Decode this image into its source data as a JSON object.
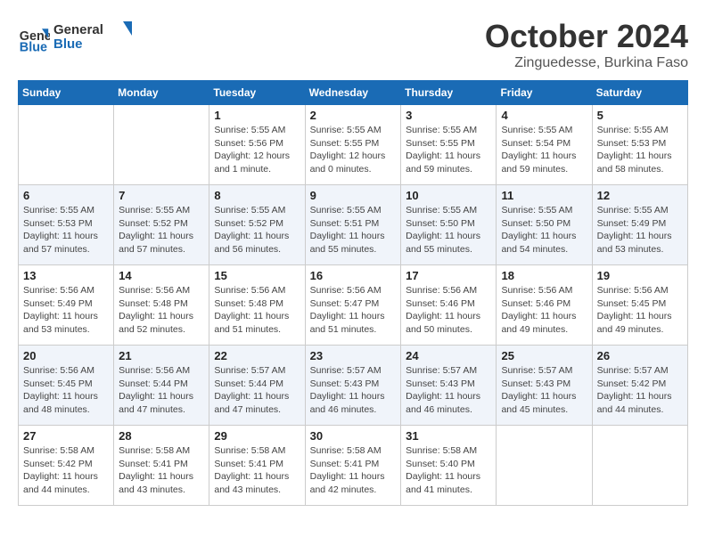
{
  "header": {
    "logo_line1": "General",
    "logo_line2": "Blue",
    "month": "October 2024",
    "location": "Zinguedesse, Burkina Faso"
  },
  "days_of_week": [
    "Sunday",
    "Monday",
    "Tuesday",
    "Wednesday",
    "Thursday",
    "Friday",
    "Saturday"
  ],
  "weeks": [
    [
      {
        "day": "",
        "info": ""
      },
      {
        "day": "",
        "info": ""
      },
      {
        "day": "1",
        "info": "Sunrise: 5:55 AM\nSunset: 5:56 PM\nDaylight: 12 hours\nand 1 minute."
      },
      {
        "day": "2",
        "info": "Sunrise: 5:55 AM\nSunset: 5:55 PM\nDaylight: 12 hours\nand 0 minutes."
      },
      {
        "day": "3",
        "info": "Sunrise: 5:55 AM\nSunset: 5:55 PM\nDaylight: 11 hours\nand 59 minutes."
      },
      {
        "day": "4",
        "info": "Sunrise: 5:55 AM\nSunset: 5:54 PM\nDaylight: 11 hours\nand 59 minutes."
      },
      {
        "day": "5",
        "info": "Sunrise: 5:55 AM\nSunset: 5:53 PM\nDaylight: 11 hours\nand 58 minutes."
      }
    ],
    [
      {
        "day": "6",
        "info": "Sunrise: 5:55 AM\nSunset: 5:53 PM\nDaylight: 11 hours\nand 57 minutes."
      },
      {
        "day": "7",
        "info": "Sunrise: 5:55 AM\nSunset: 5:52 PM\nDaylight: 11 hours\nand 57 minutes."
      },
      {
        "day": "8",
        "info": "Sunrise: 5:55 AM\nSunset: 5:52 PM\nDaylight: 11 hours\nand 56 minutes."
      },
      {
        "day": "9",
        "info": "Sunrise: 5:55 AM\nSunset: 5:51 PM\nDaylight: 11 hours\nand 55 minutes."
      },
      {
        "day": "10",
        "info": "Sunrise: 5:55 AM\nSunset: 5:50 PM\nDaylight: 11 hours\nand 55 minutes."
      },
      {
        "day": "11",
        "info": "Sunrise: 5:55 AM\nSunset: 5:50 PM\nDaylight: 11 hours\nand 54 minutes."
      },
      {
        "day": "12",
        "info": "Sunrise: 5:55 AM\nSunset: 5:49 PM\nDaylight: 11 hours\nand 53 minutes."
      }
    ],
    [
      {
        "day": "13",
        "info": "Sunrise: 5:56 AM\nSunset: 5:49 PM\nDaylight: 11 hours\nand 53 minutes."
      },
      {
        "day": "14",
        "info": "Sunrise: 5:56 AM\nSunset: 5:48 PM\nDaylight: 11 hours\nand 52 minutes."
      },
      {
        "day": "15",
        "info": "Sunrise: 5:56 AM\nSunset: 5:48 PM\nDaylight: 11 hours\nand 51 minutes."
      },
      {
        "day": "16",
        "info": "Sunrise: 5:56 AM\nSunset: 5:47 PM\nDaylight: 11 hours\nand 51 minutes."
      },
      {
        "day": "17",
        "info": "Sunrise: 5:56 AM\nSunset: 5:46 PM\nDaylight: 11 hours\nand 50 minutes."
      },
      {
        "day": "18",
        "info": "Sunrise: 5:56 AM\nSunset: 5:46 PM\nDaylight: 11 hours\nand 49 minutes."
      },
      {
        "day": "19",
        "info": "Sunrise: 5:56 AM\nSunset: 5:45 PM\nDaylight: 11 hours\nand 49 minutes."
      }
    ],
    [
      {
        "day": "20",
        "info": "Sunrise: 5:56 AM\nSunset: 5:45 PM\nDaylight: 11 hours\nand 48 minutes."
      },
      {
        "day": "21",
        "info": "Sunrise: 5:56 AM\nSunset: 5:44 PM\nDaylight: 11 hours\nand 47 minutes."
      },
      {
        "day": "22",
        "info": "Sunrise: 5:57 AM\nSunset: 5:44 PM\nDaylight: 11 hours\nand 47 minutes."
      },
      {
        "day": "23",
        "info": "Sunrise: 5:57 AM\nSunset: 5:43 PM\nDaylight: 11 hours\nand 46 minutes."
      },
      {
        "day": "24",
        "info": "Sunrise: 5:57 AM\nSunset: 5:43 PM\nDaylight: 11 hours\nand 46 minutes."
      },
      {
        "day": "25",
        "info": "Sunrise: 5:57 AM\nSunset: 5:43 PM\nDaylight: 11 hours\nand 45 minutes."
      },
      {
        "day": "26",
        "info": "Sunrise: 5:57 AM\nSunset: 5:42 PM\nDaylight: 11 hours\nand 44 minutes."
      }
    ],
    [
      {
        "day": "27",
        "info": "Sunrise: 5:58 AM\nSunset: 5:42 PM\nDaylight: 11 hours\nand 44 minutes."
      },
      {
        "day": "28",
        "info": "Sunrise: 5:58 AM\nSunset: 5:41 PM\nDaylight: 11 hours\nand 43 minutes."
      },
      {
        "day": "29",
        "info": "Sunrise: 5:58 AM\nSunset: 5:41 PM\nDaylight: 11 hours\nand 43 minutes."
      },
      {
        "day": "30",
        "info": "Sunrise: 5:58 AM\nSunset: 5:41 PM\nDaylight: 11 hours\nand 42 minutes."
      },
      {
        "day": "31",
        "info": "Sunrise: 5:58 AM\nSunset: 5:40 PM\nDaylight: 11 hours\nand 41 minutes."
      },
      {
        "day": "",
        "info": ""
      },
      {
        "day": "",
        "info": ""
      }
    ]
  ]
}
